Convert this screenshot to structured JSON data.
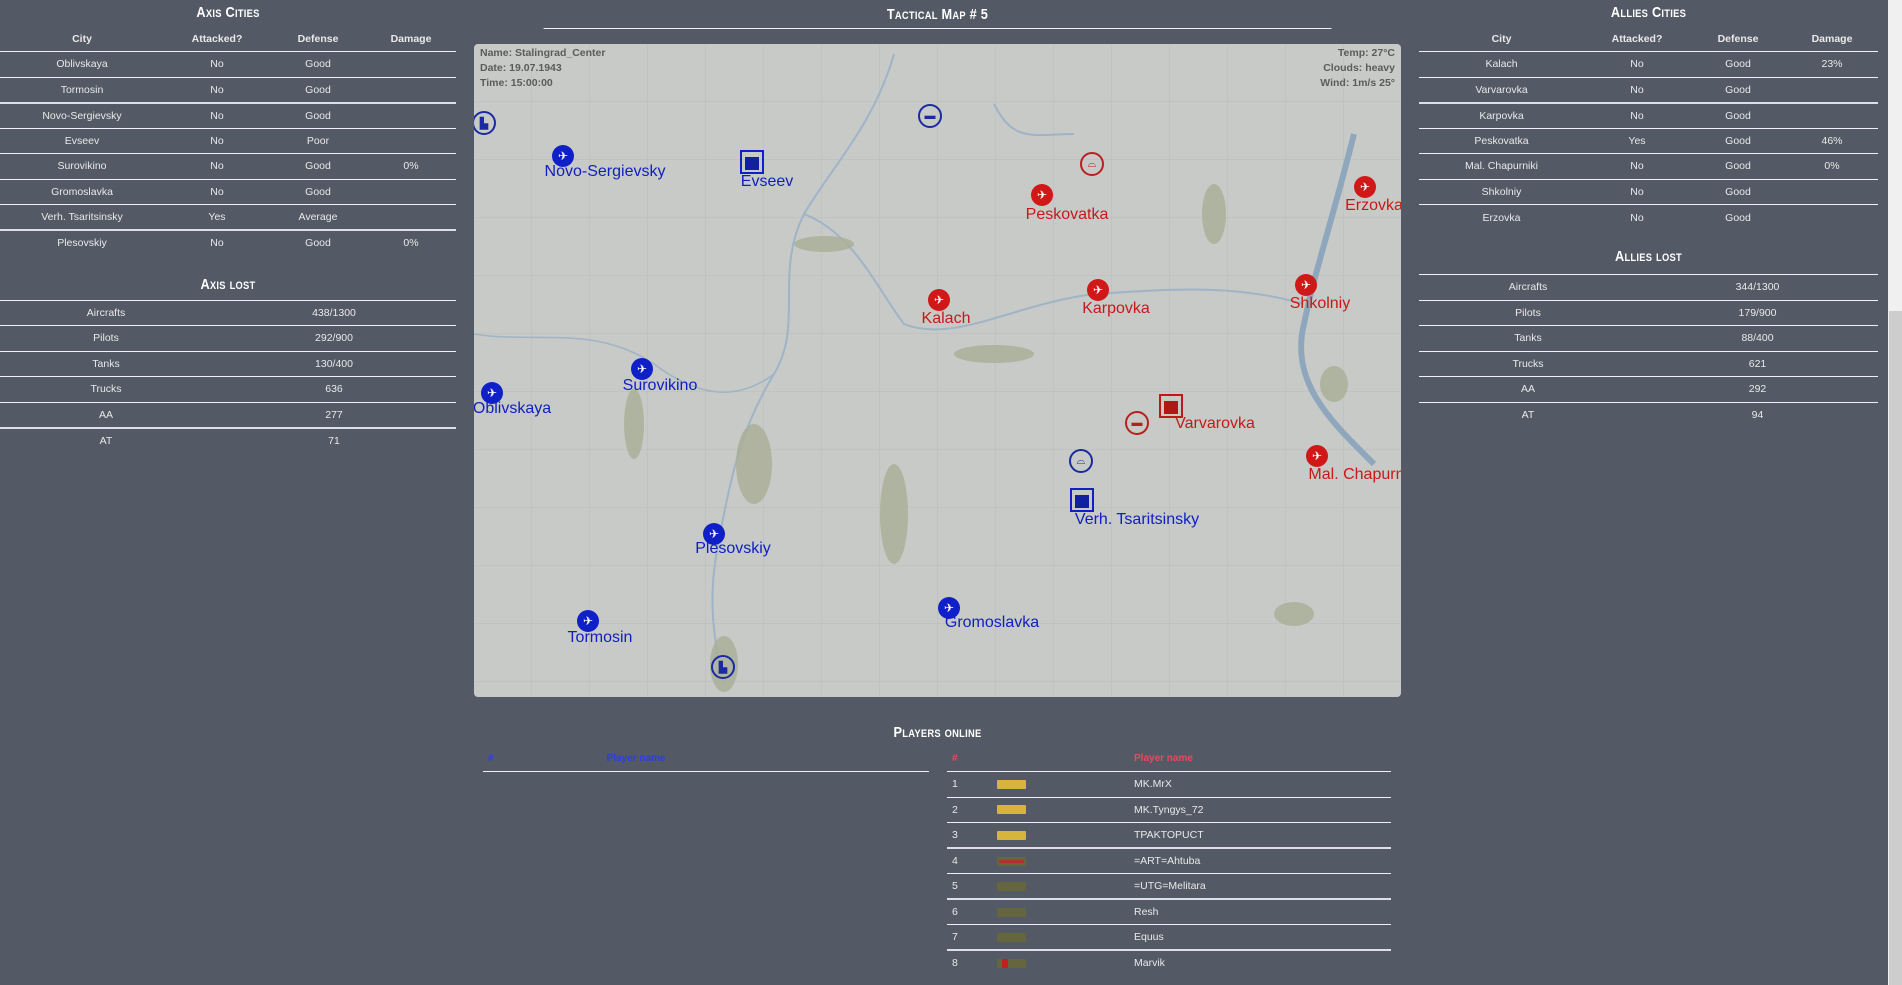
{
  "axis_cities": {
    "title": "Axis Cities",
    "headers": [
      "City",
      "Attacked?",
      "Defense",
      "Damage"
    ],
    "rows": [
      [
        "Oblivskaya",
        "No",
        "Good",
        ""
      ],
      [
        "Tormosin",
        "No",
        "Good",
        ""
      ],
      [
        "Novo-Sergievsky",
        "No",
        "Good",
        ""
      ],
      [
        "Evseev",
        "No",
        "Poor",
        ""
      ],
      [
        "Surovikino",
        "No",
        "Good",
        "0%"
      ],
      [
        "Gromoslavka",
        "No",
        "Good",
        ""
      ],
      [
        "Verh. Tsaritsinsky",
        "Yes",
        "Average",
        ""
      ],
      [
        "Plesovskiy",
        "No",
        "Good",
        "0%"
      ]
    ]
  },
  "axis_lost": {
    "title": "Axis lost",
    "rows": [
      [
        "Aircrafts",
        "438/1300"
      ],
      [
        "Pilots",
        "292/900"
      ],
      [
        "Tanks",
        "130/400"
      ],
      [
        "Trucks",
        "636"
      ],
      [
        "AA",
        "277"
      ],
      [
        "AT",
        "71"
      ]
    ]
  },
  "allies_cities": {
    "title": "Allies Cities",
    "headers": [
      "City",
      "Attacked?",
      "Defense",
      "Damage"
    ],
    "rows": [
      [
        "Kalach",
        "No",
        "Good",
        "23%"
      ],
      [
        "Varvarovka",
        "No",
        "Good",
        ""
      ],
      [
        "Karpovka",
        "No",
        "Good",
        ""
      ],
      [
        "Peskovatka",
        "Yes",
        "Good",
        "46%"
      ],
      [
        "Mal. Chapurniki",
        "No",
        "Good",
        "0%"
      ],
      [
        "Shkolniy",
        "No",
        "Good",
        ""
      ],
      [
        "Erzovka",
        "No",
        "Good",
        ""
      ]
    ]
  },
  "allies_lost": {
    "title": "Allies lost",
    "rows": [
      [
        "Aircrafts",
        "344/1300"
      ],
      [
        "Pilots",
        "179/900"
      ],
      [
        "Tanks",
        "88/400"
      ],
      [
        "Trucks",
        "621"
      ],
      [
        "AA",
        "292"
      ],
      [
        "AT",
        "94"
      ]
    ]
  },
  "map": {
    "title": "Tactical Map # 5",
    "name": "Name: Stalingrad_Center",
    "date": "Date: 19.07.1943",
    "time": "Time: 15:00:00",
    "temp": "Temp: 27°C",
    "clouds": "Clouds: heavy",
    "wind": "Wind: 1m/s 25°",
    "cities": {
      "novo": "Novo-Sergievsky",
      "evseev": "Evseev",
      "peskovatka": "Peskovatka",
      "erzovka": "Erzovka",
      "kalach": "Kalach",
      "karpovka": "Karpovka",
      "shkolniy": "Shkolniy",
      "surovikino": "Surovikino",
      "oblivskaya": "Oblivskaya",
      "varvarovka": "Varvarovka",
      "chapurniki": "Mal. Chapurniki",
      "verh": "Verh. Tsaritsinsky",
      "plesovskiy": "Plesovskiy",
      "gromoslavka": "Gromoslavka",
      "tormosin": "Tormosin"
    },
    "colors": {
      "axis": "#1020c8",
      "allies": "#d01818"
    }
  },
  "players": {
    "title": "Players online",
    "axis": {
      "headers": [
        "#",
        "Player name"
      ],
      "rows": []
    },
    "allies": {
      "headers": [
        "#",
        "Player name"
      ],
      "rows": [
        {
          "n": "1",
          "name": "MK.MrX",
          "rank": "gold"
        },
        {
          "n": "2",
          "name": "MK.Tyngys_72",
          "rank": "gold"
        },
        {
          "n": "3",
          "name": "TPAKTOPUCT",
          "rank": "gold"
        },
        {
          "n": "4",
          "name": "=ART=Ahtuba",
          "rank": "olive-stripe"
        },
        {
          "n": "5",
          "name": "=UTG=Melitara",
          "rank": "olive"
        },
        {
          "n": "6",
          "name": "Resh",
          "rank": "olive"
        },
        {
          "n": "7",
          "name": "Equus",
          "rank": "olive"
        },
        {
          "n": "8",
          "name": "Marvik",
          "rank": "olive-red"
        }
      ]
    }
  }
}
